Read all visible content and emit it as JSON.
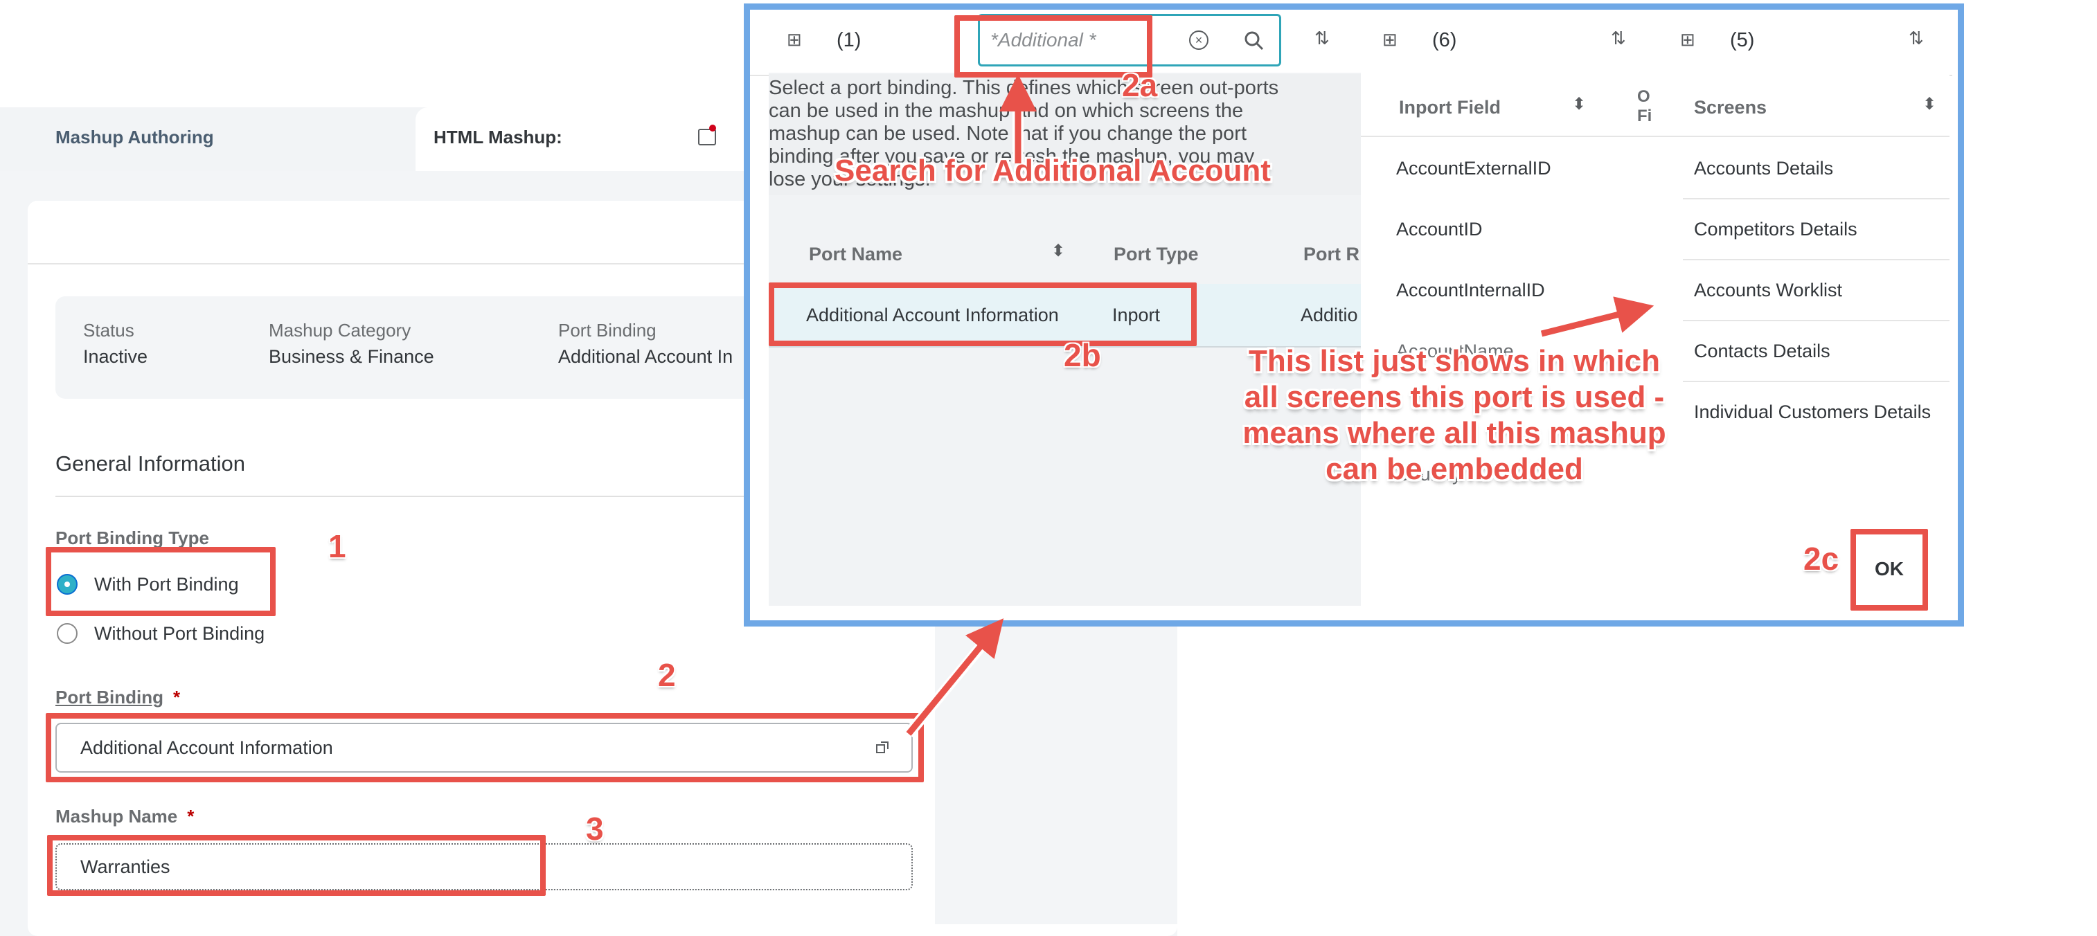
{
  "app": {
    "tabs": [
      {
        "label": "Mashup Authoring"
      },
      {
        "label": "HTML Mashup:"
      }
    ]
  },
  "summary": {
    "status_label": "Status",
    "status_value": "Inactive",
    "category_label": "Mashup Category",
    "category_value": "Business & Finance",
    "binding_label": "Port Binding",
    "binding_value": "Additional Account In"
  },
  "general": {
    "section_title": "General Information",
    "port_binding_type_label": "Port Binding Type",
    "radio_with": "With Port Binding",
    "radio_without": "Without Port Binding",
    "port_binding_label": "Port Binding",
    "port_binding_required": "*",
    "port_binding_value": "Additional Account Information",
    "mashup_name_label": "Mashup Name",
    "mashup_name_required": "*",
    "mashup_name_value": "Warranties"
  },
  "dialog": {
    "left_count": "(1)",
    "search_value": "*Additional *",
    "mid_count": "(6)",
    "right_count": "(5)",
    "intro_line1": "Select a port binding. This defines which screen out-ports",
    "intro_line2": "can be used in the mashup and on which screens the",
    "intro_line3": "mashup can be used. Note that if you change the port",
    "intro_line4": "binding after you save or refresh the mashup, you may",
    "intro_line5": "lose your settings.",
    "port_table": {
      "headers": {
        "name": "Port Name",
        "type": "Port Type",
        "ref": "Port R"
      },
      "row": {
        "name": "Additional Account Information",
        "type": "Inport",
        "ref": "Additio"
      }
    },
    "inport_table": {
      "headers": {
        "field": "Inport Field",
        "out": "O",
        "out2": "Fi"
      },
      "rows": [
        "AccountExternalID",
        "AccountID",
        "AccountInternalID",
        "AccountName",
        "Country"
      ]
    },
    "screens_table": {
      "header": "Screens",
      "rows": [
        "Accounts Details",
        "Competitors Details",
        "Accounts Worklist",
        "Contacts Details",
        "Individual Customers Details"
      ]
    },
    "ok_label": "OK"
  },
  "annotations": {
    "n1": "1",
    "n2": "2",
    "n3": "3",
    "n2a": "2a",
    "n2b": "2b",
    "n2c": "2c",
    "search_callout": "Search for Additional Account",
    "list_callout_1": "This list just shows in which",
    "list_callout_2": "all screens this port is used -",
    "list_callout_3": "means where all this mashup",
    "list_callout_4": "can be embedded",
    "accent_color": "#e8524a",
    "dialog_border_color": "#6fa8e6"
  }
}
